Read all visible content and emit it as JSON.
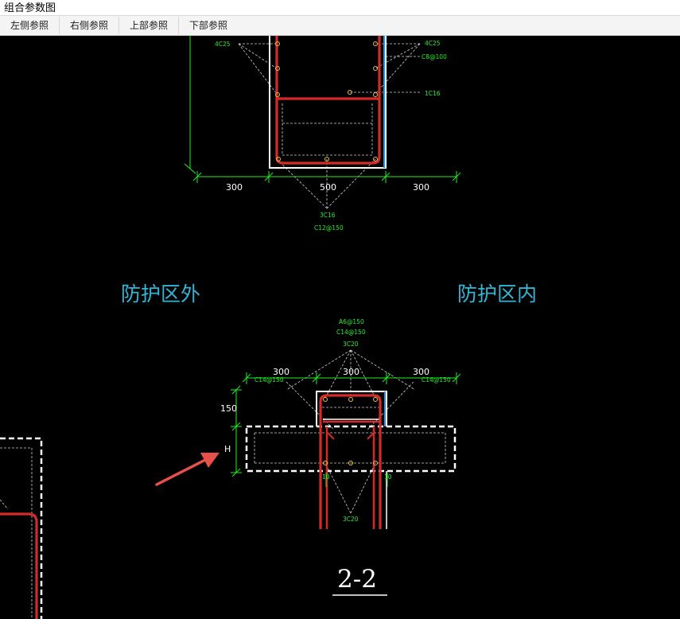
{
  "window": {
    "title": "组合参数图"
  },
  "toolbar": {
    "left_ref": "左侧参照",
    "right_ref": "右侧参照",
    "top_ref": "上部参照",
    "bottom_ref": "下部参照"
  },
  "drawing": {
    "top_section": {
      "label_left": "4C25",
      "label_right": "4C25",
      "stirrup": "C8@100",
      "bar_1c16": "1C16",
      "dim_left": "300",
      "dim_mid": "500",
      "dim_right": "300",
      "bottom_bars": "3C16",
      "bottom_stirrup": "C12@150"
    },
    "zone_outside": "防护区外",
    "zone_inside": "防护区内",
    "bottom_section": {
      "stirrup_a": "A6@150",
      "stirrup_c": "C14@150",
      "top_bars": "3C20",
      "dim_left": "300",
      "dim_mid": "300",
      "dim_right": "300",
      "slab_left": "C14@150",
      "slab_right": "C14@150",
      "dim_150": "150",
      "dim_h": "H",
      "bottom_bars": "3C20",
      "small_left": "10",
      "small_right": "10",
      "title": "2-2"
    }
  },
  "colors": {
    "rebar": "#d42a2a",
    "dimension": "#22ee22",
    "zone_text": "#2fb8d8",
    "outline": "#ffffff",
    "accent_blue": "#2a8fe0",
    "arrow": "#e8504a"
  }
}
